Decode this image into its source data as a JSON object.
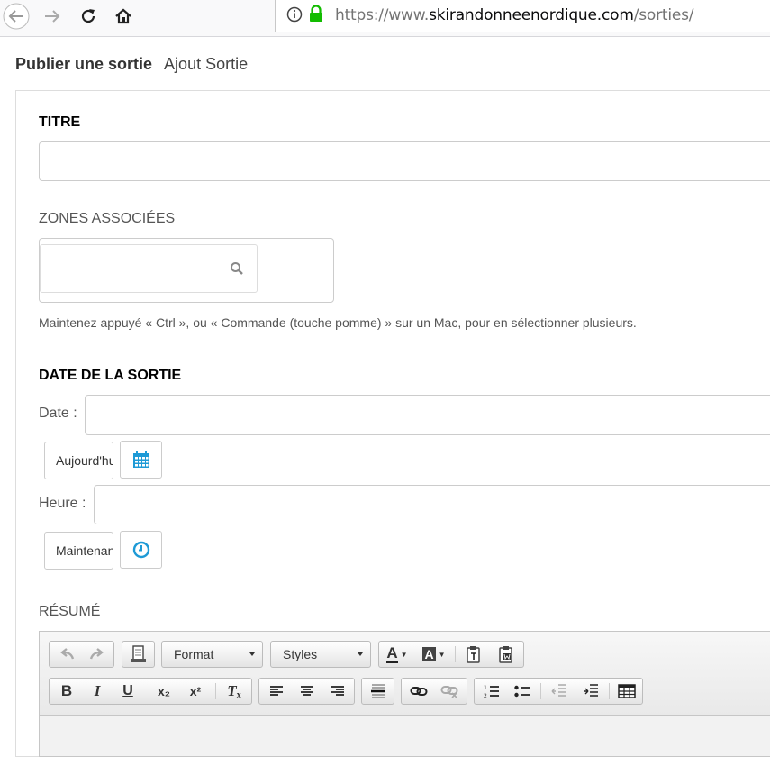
{
  "browser": {
    "url_prefix": "https://www.",
    "url_domain": "skirandonneenordique.com",
    "url_path": "/sorties/"
  },
  "page": {
    "heading": "Publier une sortie",
    "subheading": "Ajout Sortie"
  },
  "form": {
    "titre_label": "TITRE",
    "zones_label": "ZONES ASSOCIÉES",
    "zones_help": "Maintenez appuyé « Ctrl », ou « Commande (touche pomme) » sur un Mac, pour en sélectionner plusieurs.",
    "date_section_label": "DATE DE LA SORTIE",
    "date_label": "Date :",
    "today_button": "Aujourd'hui",
    "heure_label": "Heure :",
    "now_button": "Maintenant",
    "resume_label": "RÉSUMÉ"
  },
  "editor": {
    "format_label": "Format",
    "styles_label": "Styles",
    "bold_glyph": "B",
    "italic_glyph": "I",
    "underline_glyph": "U",
    "subscript_glyph": "x₂",
    "superscript_glyph": "x²",
    "remove_format_glyph": "T",
    "text_color_glyph": "A",
    "bg_color_glyph": "A"
  },
  "colors": {
    "accent_blue": "#1e9ad6",
    "lock_green": "#12bc00"
  }
}
